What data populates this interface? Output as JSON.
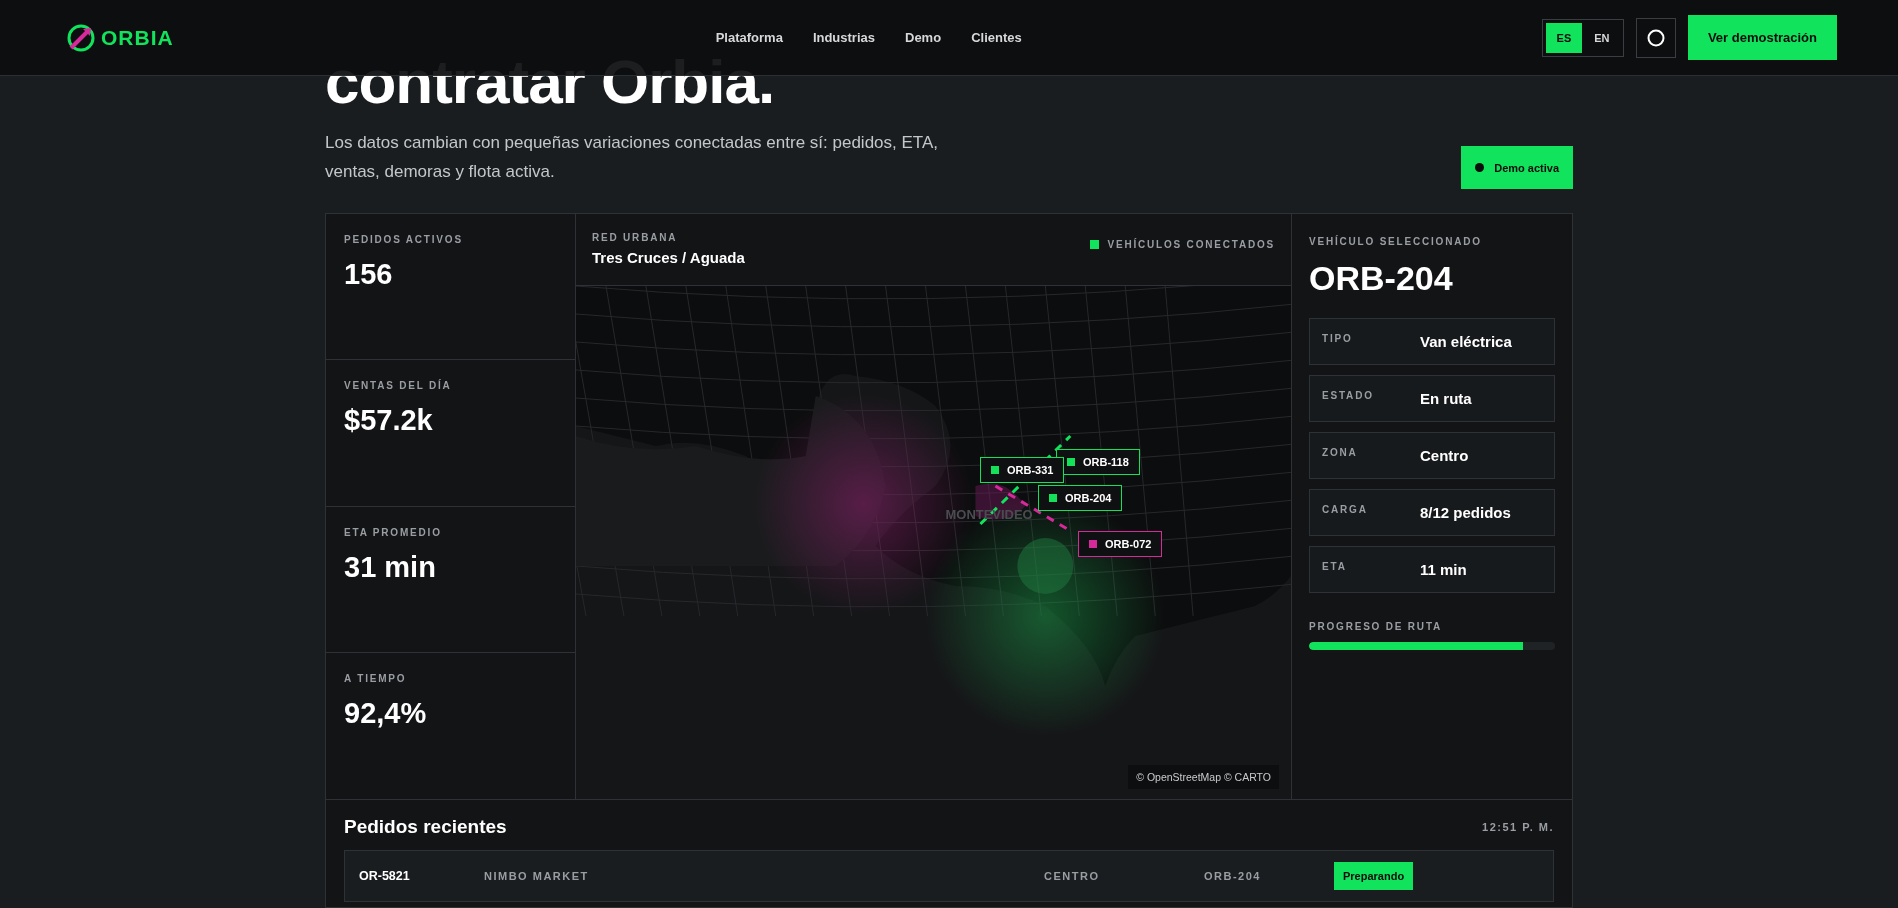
{
  "header": {
    "logo": "ORBIA",
    "nav": [
      {
        "label": "Plataforma"
      },
      {
        "label": "Industrias"
      },
      {
        "label": "Demo"
      },
      {
        "label": "Clientes"
      }
    ],
    "languages": [
      {
        "label": "ES",
        "selected": true
      },
      {
        "label": "EN",
        "selected": false
      }
    ],
    "cta": "Ver demostración"
  },
  "hero": {
    "title_lines": [
      "contratar Orbia."
    ],
    "description": "Los datos cambian con pequeñas variaciones conectadas entre sí: pedidos, ETA, ventas, demoras y flota activa.",
    "badge": "Demo activa"
  },
  "kpis": [
    {
      "label": "PEDIDOS ACTIVOS",
      "value": "156"
    },
    {
      "label": "VENTAS DEL DÍA",
      "value": "$57.2k"
    },
    {
      "label": "ETA PROMEDIO",
      "value": "31 min"
    },
    {
      "label": "A TIEMPO",
      "value": "92,4%"
    }
  ],
  "map": {
    "eyebrow": "RED URBANA",
    "title": "Tres Cruces / Aguada",
    "legend": "VEHÍCULOS CONECTADOS",
    "city_label": "MONTEVIDEO",
    "attribution": "© OpenStreetMap © CARTO",
    "markers": [
      {
        "label": "ORB-118",
        "color": "#14e05a"
      },
      {
        "label": "ORB-331",
        "color": "#14e05a"
      },
      {
        "label": "ORB-204",
        "color": "#14e05a"
      },
      {
        "label": "ORB-072",
        "color": "#d62a9a"
      }
    ]
  },
  "vehicle": {
    "eyebrow": "VEHÍCULO SELECCIONADO",
    "id": "ORB-204",
    "fields": [
      {
        "label": "TIPO",
        "value": "Van eléctrica"
      },
      {
        "label": "ESTADO",
        "value": "En ruta"
      },
      {
        "label": "ZONA",
        "value": "Centro"
      },
      {
        "label": "CARGA",
        "value": "8/12 pedidos"
      },
      {
        "label": "ETA",
        "value": "11 min"
      }
    ],
    "progress_label": "PROGRESO DE RUTA",
    "level": 0.87
  },
  "orders": {
    "title": "Pedidos recientes",
    "time": "12:51 P. M.",
    "rows": [
      {
        "id": "OR-5821",
        "client": "NIMBO MARKET",
        "zone": "CENTRO",
        "vehicle": "ORB-204",
        "status": "Preparando"
      }
    ]
  }
}
